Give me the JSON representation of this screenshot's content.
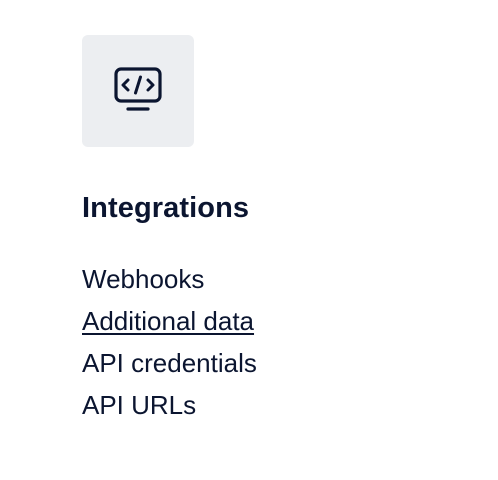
{
  "section": {
    "icon": "code-monitor-icon",
    "title": "Integrations"
  },
  "links": [
    {
      "label": "Webhooks",
      "active": false
    },
    {
      "label": "Additional data",
      "active": true
    },
    {
      "label": "API credentials",
      "active": false
    },
    {
      "label": "API URLs",
      "active": false
    }
  ],
  "colors": {
    "text": "#0b1530",
    "icon_tile_bg": "#eceef1"
  }
}
